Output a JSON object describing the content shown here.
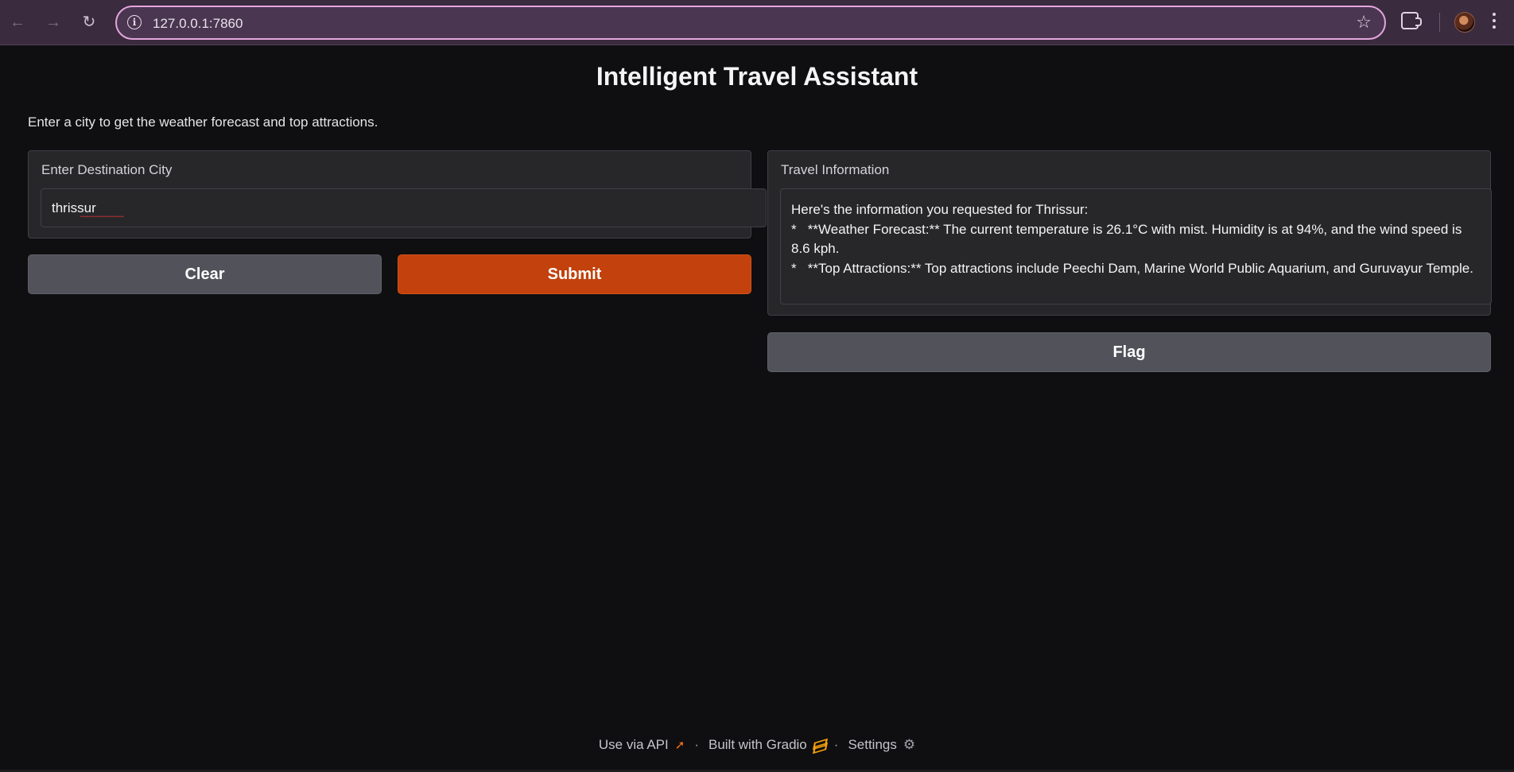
{
  "browser": {
    "url": "127.0.0.1:7860",
    "back_icon": "arrow-left-icon",
    "forward_icon": "arrow-right-icon",
    "reload_icon": "reload-icon",
    "info_icon": "info-icon",
    "bookmark_icon": "star-icon",
    "extensions_icon": "puzzle-icon",
    "menu_icon": "kebab-menu-icon"
  },
  "app": {
    "title": "Intelligent Travel Assistant",
    "description": "Enter a city to get the weather forecast and top attractions."
  },
  "input_panel": {
    "label": "Enter Destination City",
    "value": "thrissur"
  },
  "buttons": {
    "clear": "Clear",
    "submit": "Submit",
    "flag": "Flag"
  },
  "output_panel": {
    "label": "Travel Information",
    "lines": [
      "Here's the information you requested for Thrissur:",
      "",
      "*   **Weather Forecast:** The current temperature is 26.1°C with mist. Humidity is at 94%, and the wind speed is 8.6 kph.",
      "*   **Top Attractions:** Top attractions include Peechi Dam, Marine World Public Aquarium, and Guruvayur Temple."
    ]
  },
  "footer": {
    "api": "Use via API",
    "built": "Built with Gradio",
    "settings": "Settings",
    "separator": "·"
  },
  "colors": {
    "primary": "#c2410c",
    "secondary": "#52525b",
    "background": "#0f0f11",
    "panel": "#27272a"
  }
}
